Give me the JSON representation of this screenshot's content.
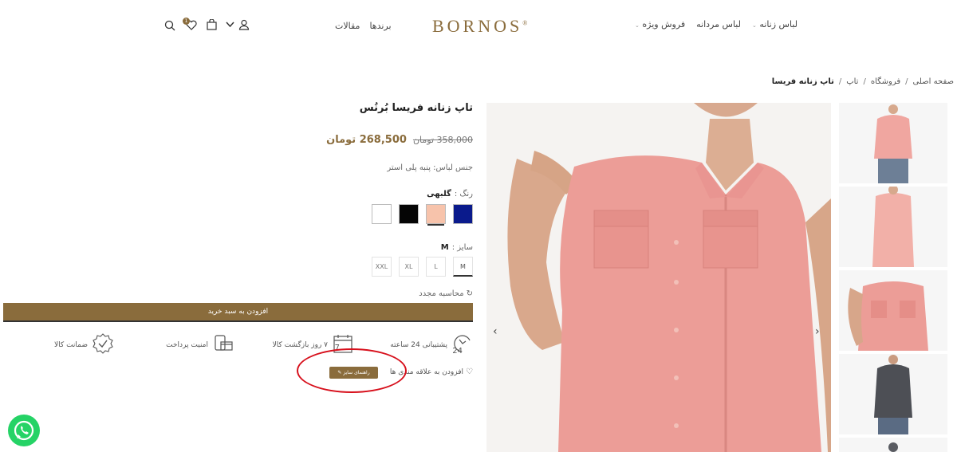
{
  "header": {
    "brand": "BORNOS",
    "brand_mark": "®",
    "nav_right": [
      {
        "label": "لباس زنانه",
        "has_dropdown": true
      },
      {
        "label": "لباس مردانه",
        "has_dropdown": false
      },
      {
        "label": "فروش ویژه",
        "has_dropdown": true
      }
    ],
    "nav_left": [
      {
        "label": "برندها"
      },
      {
        "label": "مقالات"
      }
    ],
    "wishlist_count": "1",
    "icons": [
      "search-icon",
      "heart-icon",
      "bag-icon",
      "chevron-down-icon",
      "user-icon"
    ]
  },
  "breadcrumb": {
    "items": [
      "صفحه اصلی",
      "فروشگاه",
      "تاپ"
    ],
    "current": "تاپ زنانه فریسا",
    "separator": "/"
  },
  "product": {
    "title": "تاپ زنانه فریسا بُرنُس",
    "old_price": "358,000 تومان",
    "price": "268,500 تومان",
    "material": "جنس لباس: پنبه پلی استر",
    "color_label": "رنگ :",
    "color_value": "گلبهی",
    "colors": [
      {
        "name": "navy",
        "hex": "#0a1a8c"
      },
      {
        "name": "peach",
        "hex": "#f7c3ab"
      },
      {
        "name": "black",
        "hex": "#050505"
      },
      {
        "name": "white",
        "hex": "#ffffff"
      }
    ],
    "size_label": "سایز :",
    "size_value": "M",
    "sizes": [
      "M",
      "L",
      "XL",
      "XXL"
    ],
    "recalc": "محاسبه مجدد",
    "add_to_cart": "افزودن به سبد خرید",
    "wishlist": "افزودن به علاقه مندی ها",
    "size_guide": "راهنمای سایز"
  },
  "features": [
    {
      "label": "پشتیبانی 24 ساعته",
      "icon": "support-24-icon"
    },
    {
      "label": "۷ روز بازگشت کالا",
      "icon": "calendar-return-icon"
    },
    {
      "label": "امنیت پرداخت",
      "icon": "secure-payment-icon"
    },
    {
      "label": "ضمانت کالا",
      "icon": "guarantee-icon"
    }
  ],
  "gallery": {
    "prev_icon": "chevron-left-icon",
    "next_icon": "chevron-right-icon"
  },
  "colors": {
    "accent": "#8a6c3c",
    "highlight_circle": "#d7101c",
    "whatsapp": "#25d366"
  }
}
